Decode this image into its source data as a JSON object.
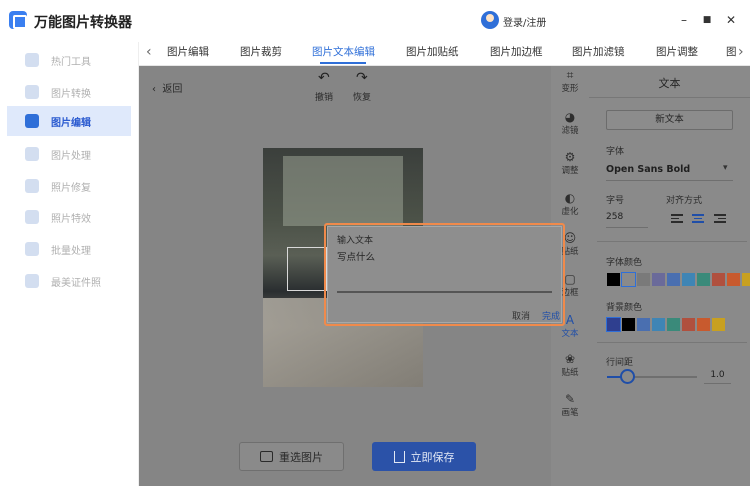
{
  "app": {
    "title": "万能图片转换器",
    "login": "登录/注册"
  },
  "window": {
    "minimize": "–",
    "maximize": "■",
    "close": "✕"
  },
  "sidebar": {
    "items": [
      {
        "label": "热门工具"
      },
      {
        "label": "图片转换"
      },
      {
        "label": "图片编辑",
        "active": true
      },
      {
        "label": "图片处理"
      },
      {
        "label": "照片修复"
      },
      {
        "label": "照片特效"
      },
      {
        "label": "批量处理"
      },
      {
        "label": "最美证件照"
      }
    ]
  },
  "tabs": {
    "items": [
      "图片编辑",
      "图片裁剪",
      "图片文本编辑",
      "图片加贴纸",
      "图片加边框",
      "图片加滤镜",
      "图片调整",
      "图"
    ],
    "active": "图片文本编辑"
  },
  "editor": {
    "back": "返回",
    "undo": "撤销",
    "redo": "恢复",
    "reselect": "重选图片",
    "save": "立即保存"
  },
  "tools": [
    "变形",
    "滤镜",
    "调整",
    "虚化",
    "贴纸",
    "边框",
    "文本",
    "贴纸",
    "画笔"
  ],
  "tools_active": "文本",
  "panel": {
    "title": "文本",
    "new_text": "新文本",
    "font_label": "字体",
    "font_value": "Open Sans Bold",
    "size_label": "字号",
    "size_value": "258",
    "align_label": "对齐方式",
    "font_color_label": "字体颜色",
    "bg_color_label": "背景颜色",
    "line_spacing_label": "行间距",
    "line_spacing_value": "1.0",
    "font_colors": [
      "#000000",
      "#8a8a8a",
      "#7a7a7a",
      "#6a6a9a",
      "#4a6fb0",
      "#3f85b5",
      "#3a8a7a",
      "#b0503e",
      "#c85a2e",
      "#c8a020"
    ],
    "bg_colors": [
      "#2f3f8f",
      "#000000",
      "#4a6fb0",
      "#3f85b5",
      "#3a8a7a",
      "#b0503e",
      "#c85a2e",
      "#c8a020"
    ],
    "accent": "#2f6fd8"
  },
  "dialog": {
    "title": "输入文本",
    "placeholder": "写点什么",
    "cancel": "取消",
    "ok": "完成",
    "frame_color": "#f08a4b"
  }
}
